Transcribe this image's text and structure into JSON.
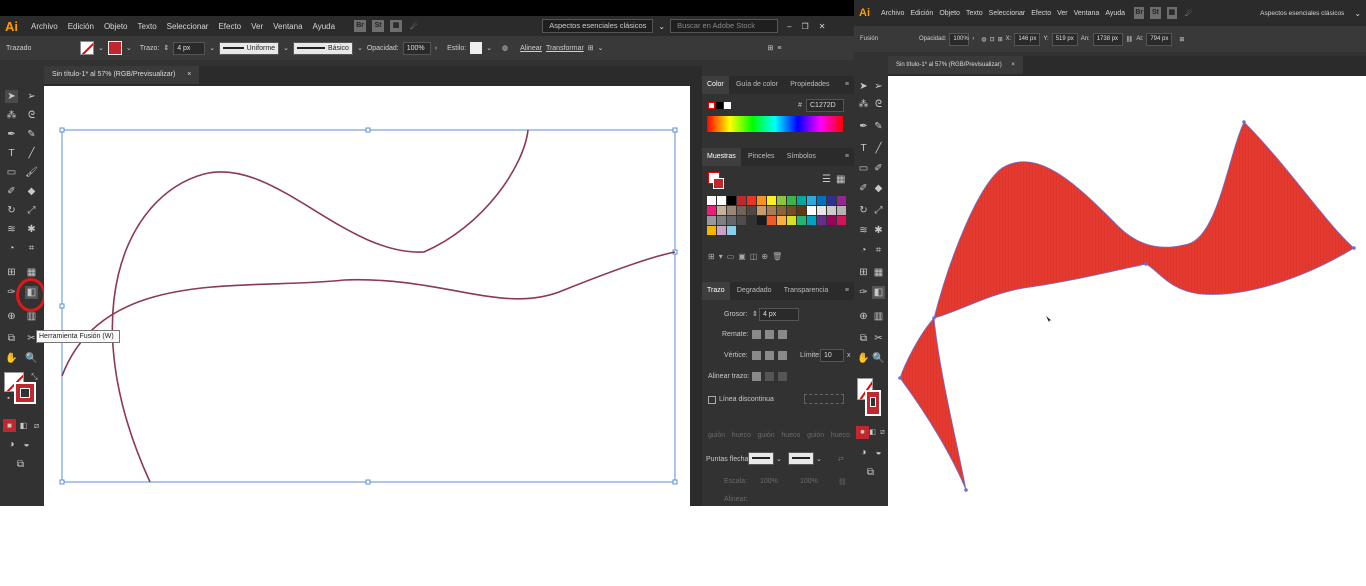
{
  "left": {
    "menu": [
      "Archivo",
      "Edición",
      "Objeto",
      "Texto",
      "Seleccionar",
      "Efecto",
      "Ver",
      "Ventana",
      "Ayuda"
    ],
    "logo": "Ai",
    "workspace": "Aspectos esenciales clásicos",
    "search_placeholder": "Buscar en Adobe Stock",
    "control": {
      "mode": "Trazado",
      "stroke_label": "Trazo:",
      "stroke_value": "4 px",
      "profile": "Uniforme",
      "brush": "Básico",
      "opacity_label": "Opacidad:",
      "opacity_value": "100%",
      "style_label": "Estilo:",
      "align": "Alinear",
      "transform": "Transformar"
    },
    "doc_tab": "Sin título-1* al 57% (RGB/Previsualizar)",
    "tooltip": "Herramienta Fusión (W)",
    "color_panel": {
      "tabs": [
        "Color",
        "Guía de color",
        "Propiedades"
      ],
      "hex_value": "C1272D"
    },
    "swatches_panel": {
      "tabs": [
        "Muestras",
        "Pinceles",
        "Símbolos"
      ]
    },
    "stroke_panel": {
      "tabs": [
        "Trazo",
        "Degradado",
        "Transparencia"
      ],
      "weight_label": "Grosor:",
      "weight_value": "4 px",
      "cap_label": "Remate:",
      "corner_label": "Vértice:",
      "limit_label": "Límite:",
      "limit_value": "10",
      "align_label": "Alinear trazo:",
      "dashed_label": "Línea discontinua",
      "dash_fields": [
        "guión",
        "hueco",
        "guión",
        "hueco",
        "guión",
        "hueco"
      ],
      "arrows_label": "Puntas flecha:",
      "scale_label": "Escala:",
      "scale_value1": "100%",
      "scale_value2": "100%",
      "align_arrows_label": "Alinear:"
    },
    "colors": {
      "stroke_red": "#C1272D",
      "curve": "#8b3a4f",
      "selection": "#5a8fd6"
    }
  },
  "right": {
    "menu": [
      "Archivo",
      "Edición",
      "Objeto",
      "Texto",
      "Seleccionar",
      "Efecto",
      "Ver",
      "Ventana",
      "Ayuda"
    ],
    "workspace": "Aspectos esenciales clásicos",
    "control": {
      "mode": "Fusión",
      "opacity_label": "Opacidad:",
      "opacity_value": "100%",
      "x_label": "X:",
      "x_value": "146 px",
      "y_label": "Y:",
      "y_value": "519 px",
      "w_label": "An:",
      "w_value": "1738 px",
      "h_label": "Al:",
      "h_value": "794 px"
    },
    "doc_tab": "Sin título-1* al 57% (RGB/Previsualizar)",
    "colors": {
      "fill": "#e53a2f",
      "edge": "#6b6fd6"
    }
  }
}
